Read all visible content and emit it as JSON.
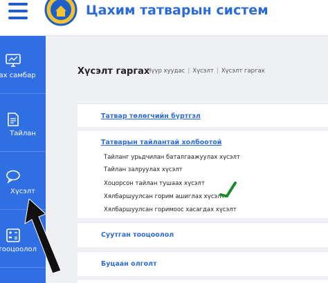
{
  "header": {
    "title": "Цахим татварын систем",
    "menu_icon": "hamburger-icon",
    "logo_icon": "tax-emblem-icon"
  },
  "sidebar": {
    "items": [
      {
        "label": "нах самбар",
        "icon": "dashboard-icon"
      },
      {
        "label": "Тайлан",
        "icon": "report-icon"
      },
      {
        "label": "Хүсэлт",
        "icon": "chat-bubble-icon"
      },
      {
        "label": "тооцоолол",
        "icon": "calculator-icon"
      }
    ]
  },
  "page": {
    "title": "Хүсэлт гаргах",
    "breadcrumb": [
      "Нүүр хуудас",
      "Хүсэлт",
      "Хүсэлт гаргах"
    ]
  },
  "cards": [
    {
      "title": "Татвар төлөгчийн бүртгэл"
    },
    {
      "title": "Татварын тайлантай холбоотой",
      "items": [
        "Тайланг урьдчилан баталгаажуулах хүсэлт",
        "Тайлан залруулах хүсэлт",
        "Хоцорсон тайлан тушаах хүсэлт",
        "Хялбаршуулсан горим ашиглах хүсэлт",
        "Хялбаршуулсан горимоос хасагдах хүсэлт"
      ]
    },
    {
      "title": "Суутган тооцоолол"
    },
    {
      "title": "Буцаан олголт"
    }
  ],
  "colors": {
    "brand_blue": "#2f6fe3",
    "link_blue": "#2c6bd6",
    "check_green": "#1a8a2a"
  }
}
